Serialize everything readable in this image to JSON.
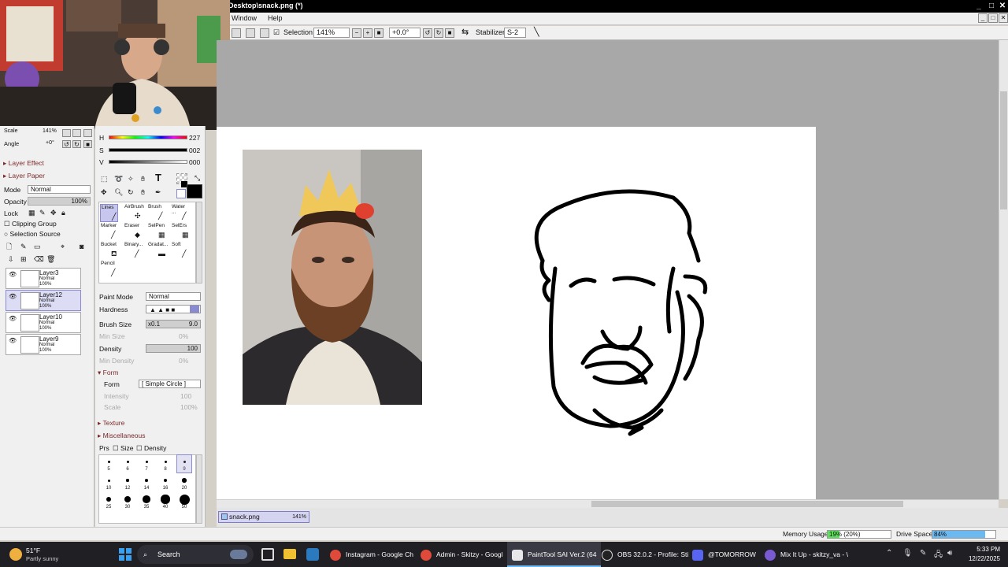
{
  "window": {
    "title": "Desktop\\snack.png (*)"
  },
  "menu": {
    "items": [
      "Window",
      "Help"
    ]
  },
  "toolbar": {
    "selection_label": "Selection",
    "zoom": "141%",
    "rotation": "+0.0°",
    "stabilizer_label": "Stabilizer",
    "stabilizer_value": "S-2"
  },
  "nav": {
    "scale_label": "Scale",
    "scale_value": "141%",
    "angle_label": "Angle",
    "angle_value": "+0°"
  },
  "layer_panel": {
    "layer_effect": "Layer Effect",
    "layer_paper": "Layer Paper",
    "mode_label": "Mode",
    "mode_value": "Normal",
    "opacity_label": "Opacity",
    "opacity_value": "100%",
    "lock_label": "Lock",
    "clipping_group": "Clipping Group",
    "selection_source": "Selection Source",
    "layers": [
      {
        "name": "Layer3",
        "mode": "Normal",
        "opacity": "100%"
      },
      {
        "name": "Layer12",
        "mode": "Normal",
        "opacity": "100%"
      },
      {
        "name": "Layer10",
        "mode": "Normal",
        "opacity": "100%"
      },
      {
        "name": "Layer9",
        "mode": "Normal",
        "opacity": "100%"
      }
    ]
  },
  "color": {
    "h_label": "H",
    "h_value": "227",
    "s_label": "S",
    "s_value": "002",
    "v_label": "V",
    "v_value": "000"
  },
  "brushes": [
    {
      "name": "Lines"
    },
    {
      "name": "AirBrush"
    },
    {
      "name": "Brush"
    },
    {
      "name": "Water ..."
    },
    {
      "name": "Marker"
    },
    {
      "name": "Eraser"
    },
    {
      "name": "SelPen"
    },
    {
      "name": "SelErs"
    },
    {
      "name": "Bucket"
    },
    {
      "name": "Binary..."
    },
    {
      "name": "Gradat..."
    },
    {
      "name": "Soft"
    },
    {
      "name": "Pencil"
    }
  ],
  "tool_settings": {
    "paint_mode_label": "Paint Mode",
    "paint_mode_value": "Normal",
    "hardness_label": "Hardness",
    "brush_size_label": "Brush Size",
    "brush_size_mult": "x0.1",
    "brush_size_value": "9.0",
    "min_size_label": "Min Size",
    "min_size_value": "0%",
    "density_label": "Density",
    "density_value": "100",
    "min_density_label": "Min Density",
    "min_density_value": "0%",
    "form_section": "Form",
    "form_label": "Form",
    "form_value": "[ Simple Circle ]",
    "intensity_label": "Intensity",
    "intensity_value": "100",
    "scale_label": "Scale",
    "scale_value": "100%",
    "texture_section": "Texture",
    "misc_section": "Miscellaneous",
    "prs_label": "Prs",
    "size_label": "Size",
    "density_chk_label": "Density"
  },
  "brush_sizes": [
    "5",
    "6",
    "7",
    "8",
    "9",
    "10",
    "12",
    "14",
    "16",
    "20",
    "25",
    "30",
    "35",
    "40",
    "50"
  ],
  "doc_tab": {
    "name": "snack.png",
    "zoom": "141%"
  },
  "status": {
    "memory_label": "Memory Usage",
    "memory_value": "19% (20%)",
    "memory_fraction": 0.19,
    "drive_label": "Drive Space",
    "drive_value": "84%",
    "drive_fraction": 0.84
  },
  "taskbar": {
    "weather_temp": "51°F",
    "weather_desc": "Partly sunny",
    "search_placeholder": "Search",
    "apps": [
      "Instagram - Google Ch",
      "Admin - Skitzy - Googl",
      "PaintTool SAI Ver.2 (64",
      "OBS 32.0.2 - Profile: Sti",
      "@TOMORROW",
      "Mix It Up - skitzy_va - \\"
    ],
    "time": "5:33 PM",
    "date": "12/22/2025"
  },
  "colors": {
    "accent": "#7c7cc8",
    "taskbar_bg": "#1f1f24",
    "canvas_bg": "#a8a8a8",
    "memory_fill": "#5ce05c",
    "drive_fill": "#6cb8f0"
  }
}
